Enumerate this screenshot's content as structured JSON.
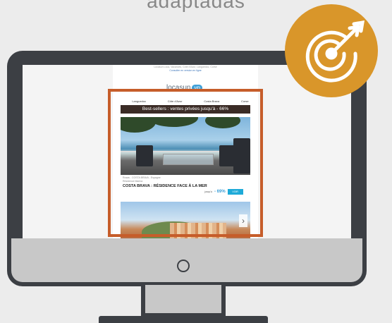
{
  "heading": "adaptadas",
  "email": {
    "preheader_line1": "Locasun Loca, Vacances, Cote d'Azur, Languedoc, Corse",
    "preheader_link": "Consulter en version en ligne",
    "logo_text": "locasun",
    "logo_badge": "vp",
    "nav": [
      "Languedoc",
      "Côte d'Azur",
      "Costa Brava",
      "Corse"
    ],
    "banner": "Best-sellers : ventes privées jusqu'à - 66%",
    "listing": {
      "location": "Rosas - COSTA BRAVA - Espagne",
      "residence": "Résidence Marina",
      "title": "COSTA BRAVA : RÉSIDENCE FACE À LA MER",
      "price_label": "jusqu'à",
      "discount": "- 69%",
      "cta": "VOIR"
    }
  },
  "colors": {
    "highlight_frame": "#c65d2a",
    "badge": "#d9962a",
    "monitor_frame": "#3c3f44",
    "banner": "#3b2c26",
    "cta": "#1eaad8"
  },
  "icons": {
    "badge_icon": "target-arrow-icon",
    "power": "power-button-icon",
    "next": "chevron-right-icon"
  }
}
